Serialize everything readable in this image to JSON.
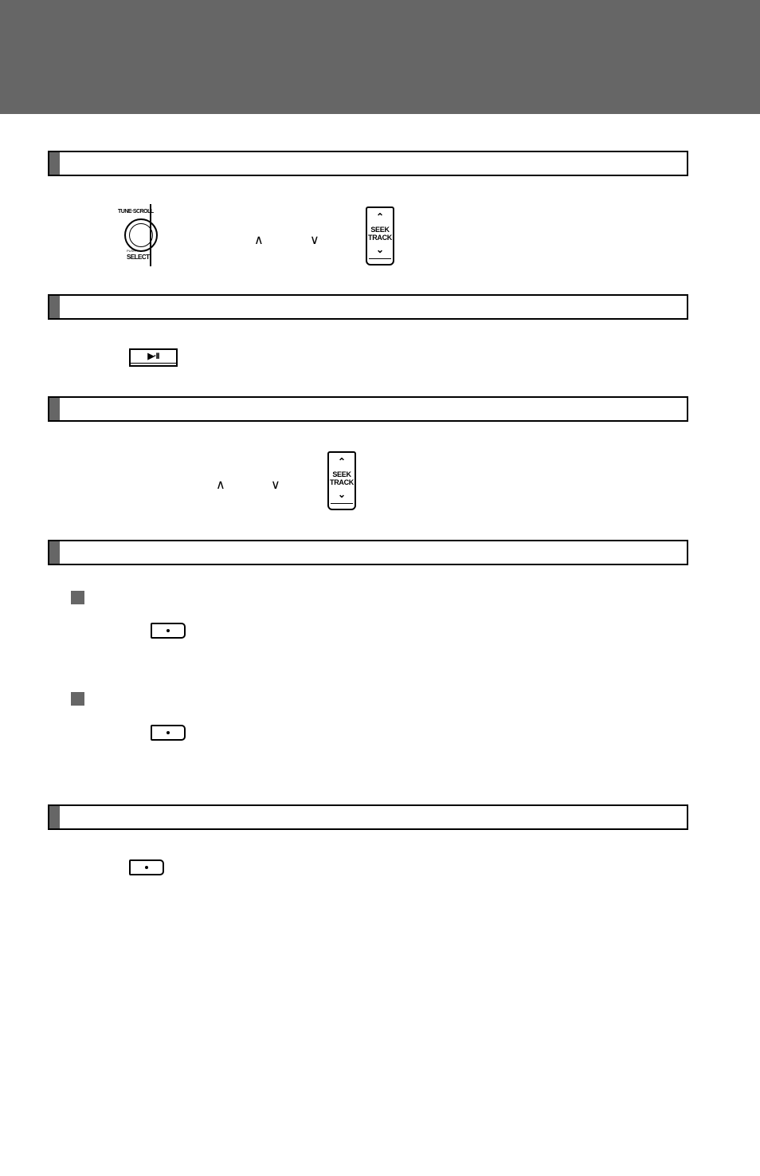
{
  "header": {
    "color": "#666666"
  },
  "sections": [
    {
      "id": "section-1",
      "title": ""
    },
    {
      "id": "section-2",
      "title": ""
    },
    {
      "id": "section-3",
      "title": ""
    },
    {
      "id": "section-4",
      "title": ""
    },
    {
      "id": "section-5",
      "title": ""
    }
  ],
  "controls": {
    "tune_knob": {
      "top_label": "TUNE·SCROLL",
      "push_label": "PUSH",
      "bottom_label": "SELECT"
    },
    "caret_up": "∧",
    "caret_down": "∨",
    "seek_switch": {
      "up_arrow": "⌃",
      "label_line1": "SEEK",
      "label_line2": "TRACK",
      "down_arrow": "⌄"
    },
    "play_pause_button": {
      "label": "▶·II"
    }
  },
  "subsections": [
    {
      "id": "subsection-1",
      "title": ""
    },
    {
      "id": "subsection-2",
      "title": ""
    }
  ]
}
